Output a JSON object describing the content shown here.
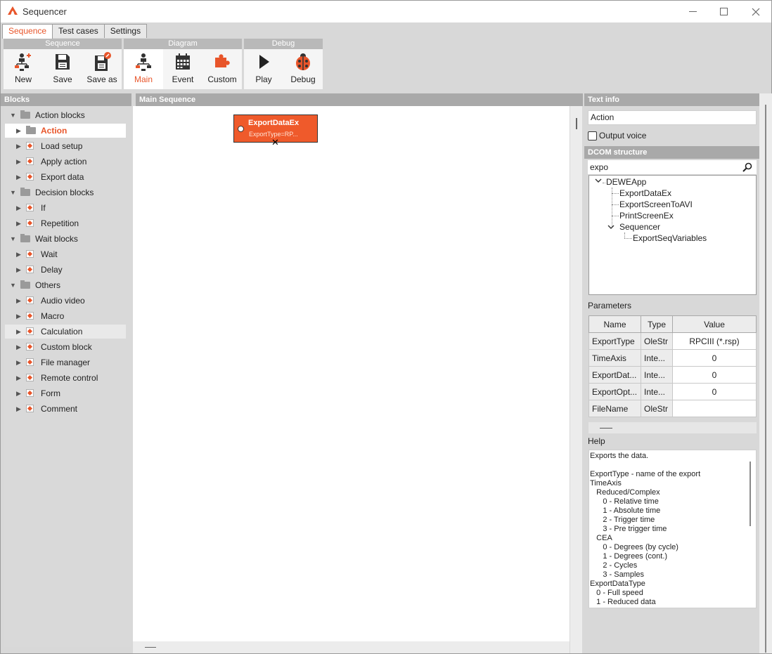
{
  "window": {
    "title": "Sequencer",
    "accent": "#e8552a"
  },
  "tabs": [
    {
      "label": "Sequence",
      "active": true
    },
    {
      "label": "Test cases",
      "active": false
    },
    {
      "label": "Settings",
      "active": false
    }
  ],
  "ribbon": {
    "groups": [
      {
        "title": "Sequence",
        "buttons": [
          {
            "label": "New",
            "icon": "new-sequence-icon"
          },
          {
            "label": "Save",
            "icon": "save-icon"
          },
          {
            "label": "Save as",
            "icon": "save-as-icon"
          }
        ]
      },
      {
        "title": "Diagram",
        "buttons": [
          {
            "label": "Main",
            "icon": "main-diagram-icon",
            "active": true
          },
          {
            "label": "Event",
            "icon": "calendar-icon"
          },
          {
            "label": "Custom",
            "icon": "puzzle-icon"
          }
        ]
      },
      {
        "title": "Debug",
        "buttons": [
          {
            "label": "Play",
            "icon": "play-icon"
          },
          {
            "label": "Debug",
            "icon": "ladybug-icon"
          }
        ]
      }
    ]
  },
  "blocks": {
    "header": "Blocks",
    "tree": [
      {
        "label": "Action blocks",
        "level": 0,
        "expanded": true,
        "kind": "folder"
      },
      {
        "label": "Action",
        "level": 1,
        "kind": "folder",
        "selected": true
      },
      {
        "label": "Load setup",
        "level": 1,
        "kind": "block"
      },
      {
        "label": "Apply action",
        "level": 1,
        "kind": "block"
      },
      {
        "label": "Export data",
        "level": 1,
        "kind": "block"
      },
      {
        "label": "Decision blocks",
        "level": 0,
        "expanded": true,
        "kind": "folder"
      },
      {
        "label": "If",
        "level": 1,
        "kind": "block"
      },
      {
        "label": "Repetition",
        "level": 1,
        "kind": "block"
      },
      {
        "label": "Wait blocks",
        "level": 0,
        "expanded": true,
        "kind": "folder"
      },
      {
        "label": "Wait",
        "level": 1,
        "kind": "block"
      },
      {
        "label": "Delay",
        "level": 1,
        "kind": "block"
      },
      {
        "label": "Others",
        "level": 0,
        "expanded": true,
        "kind": "folder"
      },
      {
        "label": "Audio video",
        "level": 1,
        "kind": "block"
      },
      {
        "label": "Macro",
        "level": 1,
        "kind": "block"
      },
      {
        "label": "Calculation",
        "level": 1,
        "kind": "block",
        "hover": true
      },
      {
        "label": "Custom block",
        "level": 1,
        "kind": "block"
      },
      {
        "label": "File manager",
        "level": 1,
        "kind": "block"
      },
      {
        "label": "Remote control",
        "level": 1,
        "kind": "block"
      },
      {
        "label": "Form",
        "level": 1,
        "kind": "block"
      },
      {
        "label": "Comment",
        "level": 1,
        "kind": "block"
      }
    ]
  },
  "main": {
    "header": "Main Sequence",
    "node": {
      "title": "ExportDataEx",
      "subtitle": "ExportType=RP..."
    }
  },
  "text_info": {
    "header": "Text info",
    "value": "Action",
    "output_voice_label": "Output voice",
    "output_voice_checked": false
  },
  "dcom": {
    "header": "DCOM structure",
    "search_value": "expo",
    "tree": [
      {
        "label": "DEWEApp"
      },
      {
        "label": "ExportDataEx"
      },
      {
        "label": "ExportScreenToAVI"
      },
      {
        "label": "PrintScreenEx"
      },
      {
        "label": "Sequencer"
      },
      {
        "label": "ExportSeqVariables"
      }
    ]
  },
  "parameters": {
    "label": "Parameters",
    "columns": [
      "Name",
      "Type",
      "Value"
    ],
    "rows": [
      {
        "name": "ExportType",
        "type": "OleStr",
        "value": "RPCIII (*.rsp)"
      },
      {
        "name": "TimeAxis",
        "type": "Inte...",
        "value": "0"
      },
      {
        "name": "ExportDat...",
        "type": "Inte...",
        "value": "0"
      },
      {
        "name": "ExportOpt...",
        "type": "Inte...",
        "value": "0"
      },
      {
        "name": "FileName",
        "type": "OleStr",
        "value": ""
      }
    ]
  },
  "help": {
    "label": "Help",
    "lines": [
      "Exports the data.",
      "",
      "ExportType - name of the export",
      "TimeAxis",
      "   Reduced/Complex",
      "      0 - Relative time",
      "      1 - Absolute time",
      "      2 - Trigger time",
      "      3 - Pre trigger time",
      "   CEA",
      "      0 - Degrees (by cycle)",
      "      1 - Degrees (cont.)",
      "      2 - Cycles",
      "      3 - Samples",
      "ExportDataType",
      "   0 - Full speed",
      "   1 - Reduced data"
    ]
  }
}
